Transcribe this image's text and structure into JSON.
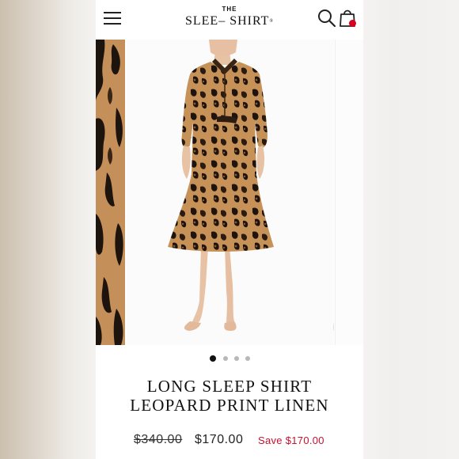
{
  "header": {
    "logo_top": "THE",
    "logo_main": "SLEE– SHIRT",
    "logo_reg": "®",
    "icons": [
      "menu-icon",
      "search-icon",
      "shopping-bag-icon"
    ],
    "cart_badge_color": "#d9001b"
  },
  "gallery": {
    "slide_count": 4,
    "active_slide": 1,
    "zoom_icon": "magnifier-icon"
  },
  "product": {
    "title_line1": "LONG SLEEP SHIRT",
    "title_line2": "LEOPARD PRINT LINEN",
    "price_original": "$340.00",
    "price_sale": "$170.00",
    "savings": "Save $170.00",
    "savings_color": "#c8102e"
  }
}
